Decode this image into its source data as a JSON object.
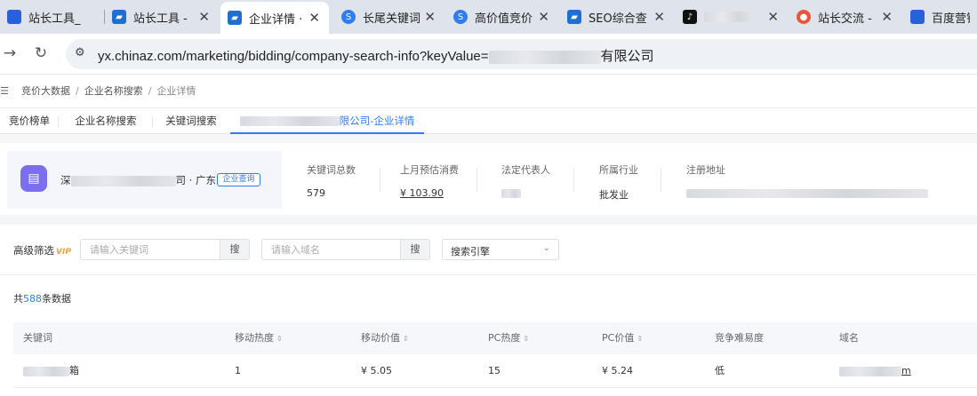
{
  "browser": {
    "tabs": [
      {
        "title": "站长工具_",
        "icon": "paw-icon",
        "active": false
      },
      {
        "title": "站长工具 -",
        "icon": "chinaz-icon",
        "active": false
      },
      {
        "title": "企业详情 ·",
        "icon": "chinaz-icon",
        "active": true
      },
      {
        "title": "长尾关键词",
        "icon": "5118-icon",
        "active": false
      },
      {
        "title": "高价值竞价",
        "icon": "5118-icon",
        "active": false
      },
      {
        "title": "SEO综合查",
        "icon": "chinaz-icon",
        "active": false
      },
      {
        "title": "",
        "icon": "tiktok-icon",
        "active": false
      },
      {
        "title": "站长交流 -",
        "icon": "flame-icon",
        "active": false
      },
      {
        "title": "百度营销 -",
        "icon": "paw-icon",
        "active": false
      }
    ],
    "url_prefix": "yx.chinaz.com/marketing/bidding/company-search-info?keyValue=",
    "url_suffix": "有限公司"
  },
  "breadcrumb": [
    "竞价大数据",
    "企业名称搜索",
    "企业详情"
  ],
  "page_tabs": [
    "竞价榜单",
    "企业名称搜索",
    "关键词搜索",
    "限公司-企业详情"
  ],
  "company": {
    "name_prefix": "深",
    "name_suffix": "司 · 广东",
    "query_button": "企业查询"
  },
  "stats": [
    {
      "label": "关键词总数",
      "value": "579"
    },
    {
      "label": "上月预估消费",
      "value": "¥  103.90"
    },
    {
      "label": "法定代表人",
      "value": ""
    },
    {
      "label": "所属行业",
      "value": "批发业"
    },
    {
      "label": "注册地址",
      "value": ""
    }
  ],
  "filters": {
    "label": "高级筛选",
    "vip_badge": "VIP",
    "keyword_placeholder": "请输入关键词",
    "domain_placeholder": "请输入域名",
    "search_label": "搜",
    "engine_select": "搜索引擎"
  },
  "total": {
    "prefix": "共",
    "count": "588",
    "suffix": "条数据"
  },
  "table": {
    "headers": [
      "关键词",
      "移动热度",
      "移动价值",
      "PC热度",
      "PC价值",
      "竞争难易度",
      "域名"
    ],
    "sortable": [
      false,
      true,
      true,
      true,
      true,
      false,
      false
    ],
    "rows": [
      {
        "keyword_suffix": "箱",
        "mobile_heat": "1",
        "mobile_value": "¥  5.05",
        "pc_heat": "15",
        "pc_value": "¥  5.24",
        "difficulty": "低",
        "domain_suffix": "m"
      }
    ]
  },
  "colors": {
    "accent": "#2d7cf6",
    "company_icon": "#7b6ff0",
    "vip": "#e8a33a"
  }
}
